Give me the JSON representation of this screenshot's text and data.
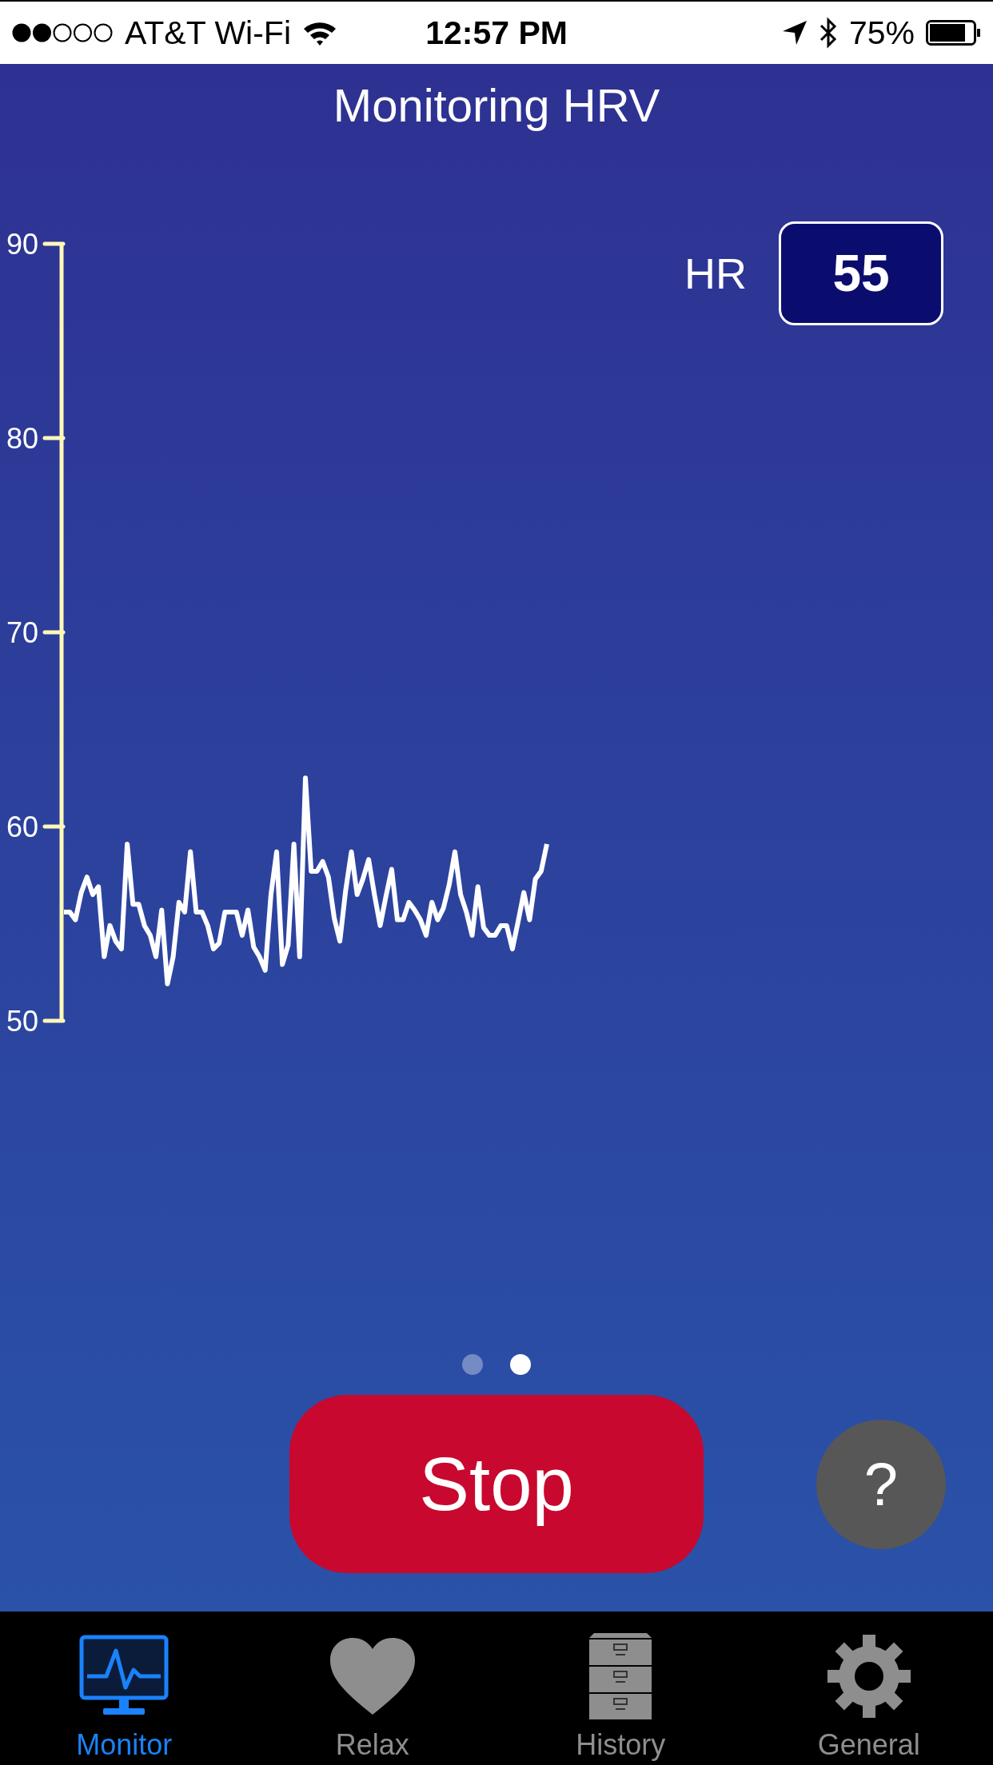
{
  "status_bar": {
    "carrier": "AT&T Wi-Fi",
    "time": "12:57 PM",
    "battery": "75%"
  },
  "title": "Monitoring HRV",
  "heart_rate": {
    "label": "HR",
    "value": "55"
  },
  "chart_data": {
    "type": "line",
    "ylim": [
      50,
      90
    ],
    "yticks": [
      50,
      60,
      70,
      80,
      90
    ],
    "series": [
      {
        "color": "#ffffff",
        "values": [
          55.6,
          55.6,
          55.2,
          56.6,
          57.4,
          56.5,
          56.9,
          53.3,
          54.9,
          54.1,
          53.7,
          59.1,
          56.0,
          56.0,
          54.9,
          54.4,
          53.3,
          55.7,
          51.9,
          53.3,
          56.1,
          55.6,
          58.7,
          55.6,
          55.6,
          54.9,
          53.7,
          54.0,
          55.6,
          55.6,
          55.6,
          54.4,
          55.7,
          53.8,
          53.3,
          52.6,
          56.5,
          58.7,
          52.9,
          53.9,
          59.1,
          53.3,
          62.5,
          57.7,
          57.7,
          58.2,
          57.4,
          55.3,
          54.1,
          56.7,
          58.7,
          56.5,
          57.3,
          58.3,
          56.5,
          54.9,
          56.4,
          57.8,
          55.2,
          55.2,
          56.1,
          55.7,
          55.2,
          54.4,
          56.1,
          55.2,
          55.8,
          57.0,
          58.7,
          56.5,
          55.6,
          54.4,
          56.9,
          54.8,
          54.4,
          54.4,
          54.9,
          54.9,
          53.7,
          55.1,
          56.6,
          55.2,
          57.3,
          57.7,
          59.1
        ]
      }
    ]
  },
  "pages": [
    {
      "selected": false
    },
    {
      "selected": true
    }
  ],
  "stop_button": "Stop",
  "help_button": "?",
  "tabs": [
    {
      "label": "Monitor",
      "kind": "monitor",
      "selected": true
    },
    {
      "label": "Relax",
      "kind": "heart",
      "selected": false
    },
    {
      "label": "History",
      "kind": "cabinet",
      "selected": false
    },
    {
      "label": "General",
      "kind": "gear",
      "selected": false
    }
  ]
}
